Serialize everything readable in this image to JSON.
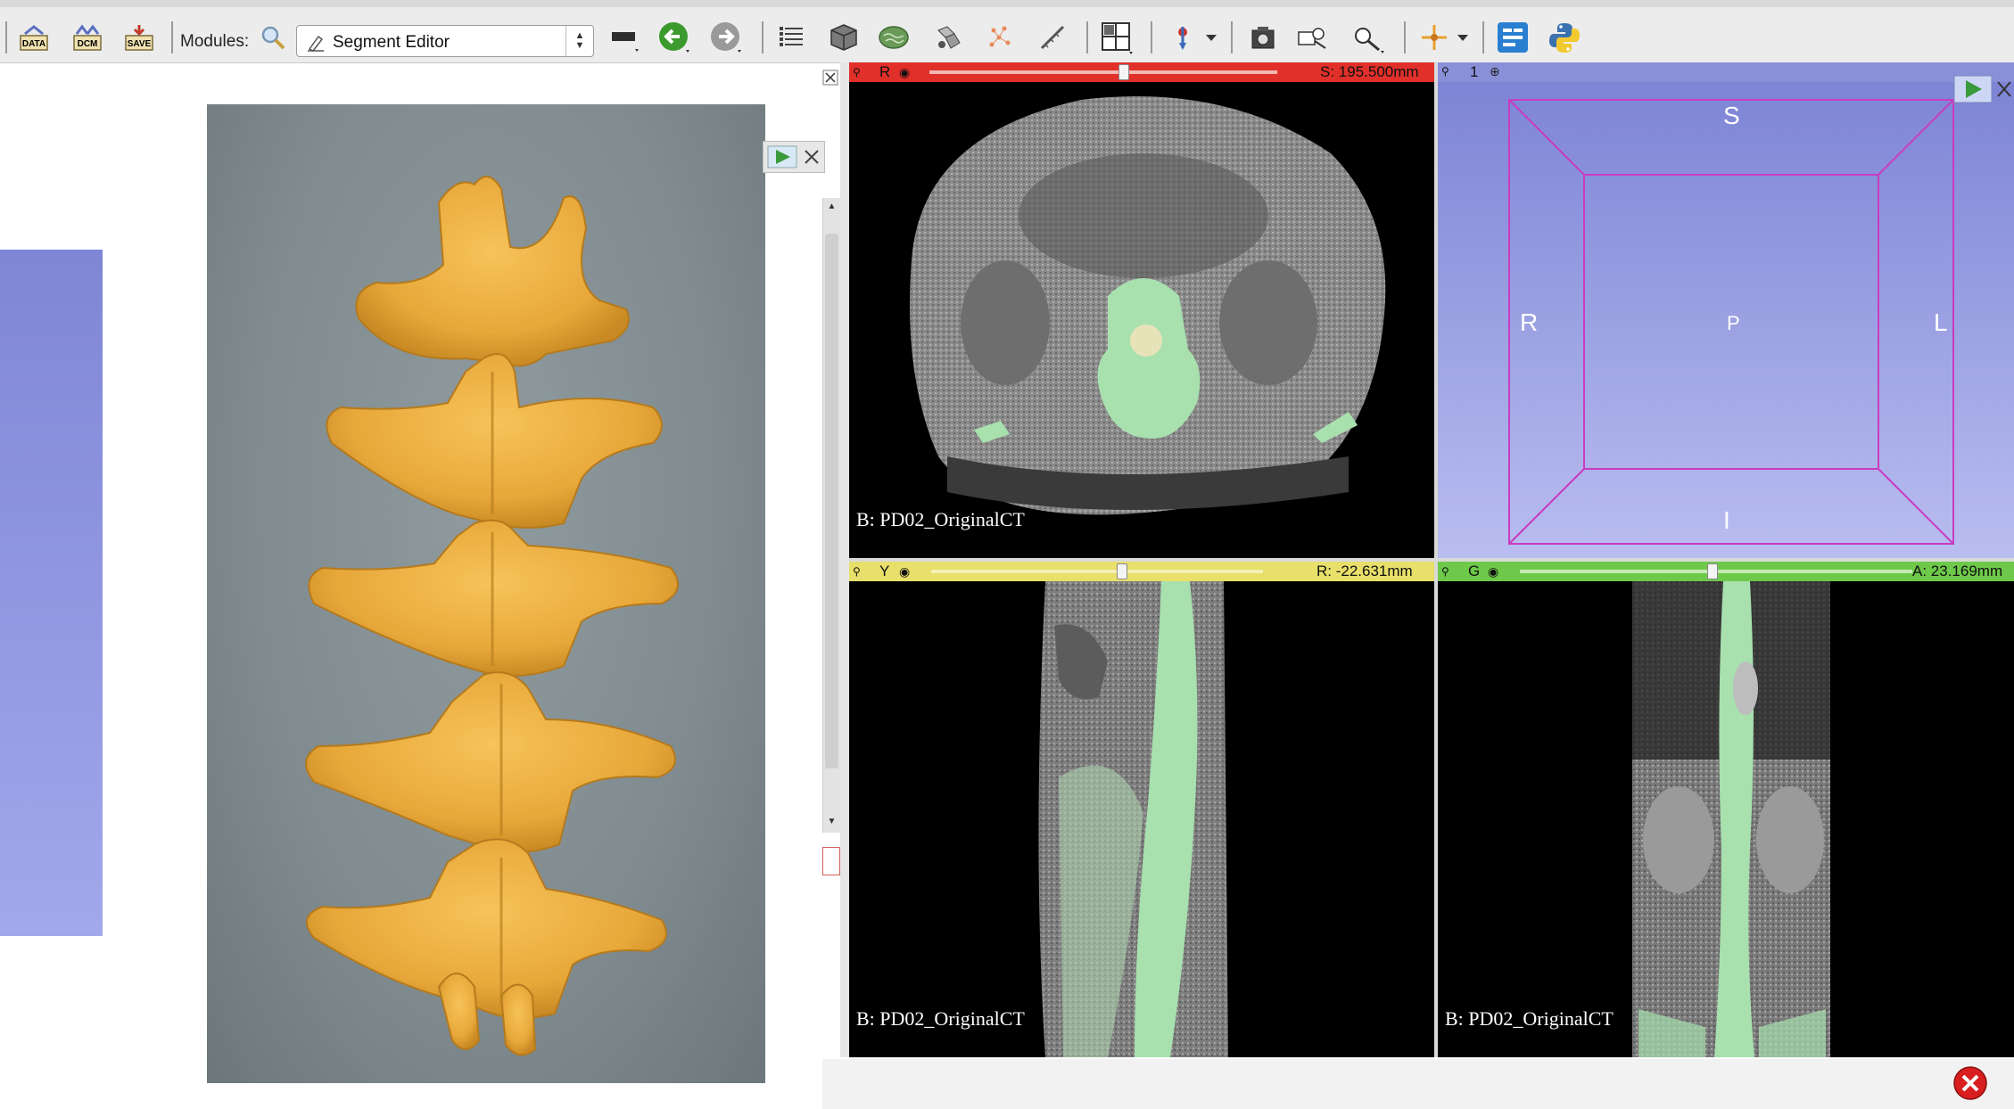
{
  "toolbar": {
    "data_label": "DATA",
    "dcm_label": "DCM",
    "save_label": "SAVE",
    "modules_label": "Modules:",
    "module_selected": "Segment Editor"
  },
  "views": {
    "red": {
      "letter": "R",
      "readout": "S: 195.500mm",
      "volume": "B: PD02_OriginalCT",
      "color": "#e1302a"
    },
    "threed": {
      "index": "1",
      "orient_top": "S",
      "orient_bottom": "I",
      "orient_left": "R",
      "orient_right": "L",
      "orient_center": "P",
      "color": "#8a90d8"
    },
    "yellow": {
      "letter": "Y",
      "readout": "R: -22.631mm",
      "volume": "B: PD02_OriginalCT",
      "color": "#e8e06a"
    },
    "green": {
      "letter": "G",
      "readout": "A: 23.169mm",
      "volume": "B: PD02_OriginalCT",
      "color": "#6ec94a"
    }
  },
  "icons": {
    "toolbar": [
      "data-icon",
      "dcm-icon",
      "save-icon",
      "search-icon",
      "edit-icon",
      "layout-icon",
      "back-arrow-icon",
      "forward-arrow-icon",
      "module-list-icon",
      "cube-icon",
      "brain-icon",
      "transform-icon",
      "markup-points-icon",
      "ruler-icon",
      "grid-layout-icon",
      "fiducial-icon",
      "screenshot-icon",
      "scene-icon",
      "tools-icon",
      "crosshair-icon",
      "extension-icon",
      "python-icon"
    ]
  },
  "colors": {
    "red_bar": "#e1302a",
    "yellow_bar": "#e8e06a",
    "green_bar": "#6ec94a",
    "threed_bar": "#8a90d8",
    "bone": "#a8e0ae",
    "model": "#e8a83a"
  }
}
